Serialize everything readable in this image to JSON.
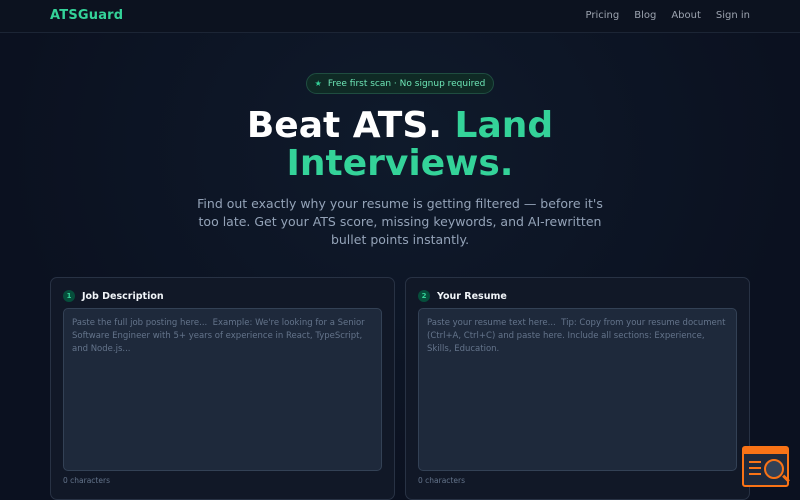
{
  "nav": {
    "logo": "ATSGuard",
    "links": [
      "Pricing",
      "Blog",
      "About",
      "Sign in"
    ]
  },
  "badge": {
    "icon": "star-icon",
    "text": "Free first scan · No signup required"
  },
  "hero": {
    "title_plain": "Beat ATS.",
    "title_accent_1": "Land",
    "title_accent_2": "Interviews.",
    "subtitle": "Find out exactly why your resume is getting filtered — before it's too late. Get your ATS score, missing keywords, and AI-rewritten bullet points instantly."
  },
  "cards": {
    "job": {
      "step": "1",
      "title": "Job Description",
      "placeholder": "Paste the full job posting here...  Example: We're looking for a Senior Software Engineer with 5+ years of experience in React, TypeScript, and Node.js...",
      "value": "",
      "char_count": "0 characters"
    },
    "resume": {
      "step": "2",
      "title": "Your Resume",
      "placeholder": "Paste your resume text here...  Tip: Copy from your resume document (Ctrl+A, Ctrl+C) and paste here. Include all sections: Experience, Skills, Education.",
      "value": "",
      "char_count": "0 characters"
    }
  },
  "colors": {
    "accent": "#34d399",
    "background": "#0b1120",
    "card": "#111827",
    "widget": "#f97316"
  }
}
